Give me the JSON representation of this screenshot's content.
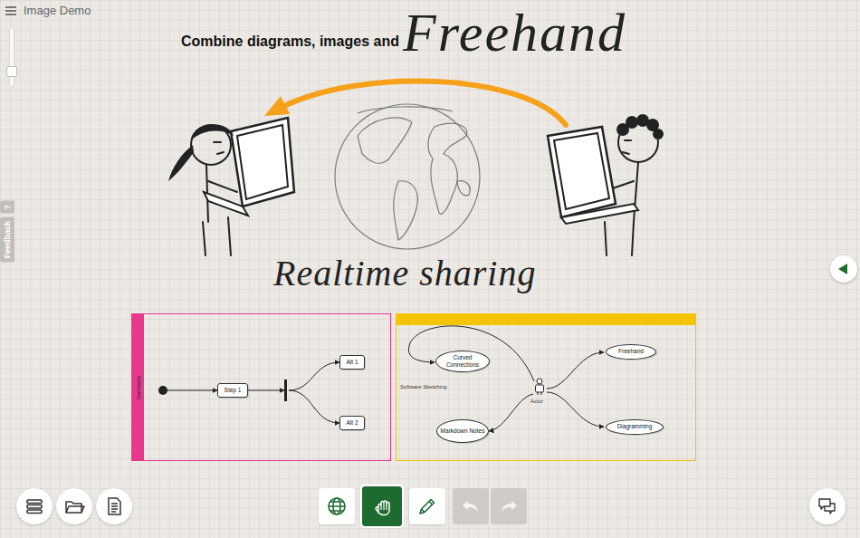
{
  "window": {
    "title": "Image Demo"
  },
  "zoom": {
    "level": 0.2
  },
  "side_tabs": [
    {
      "label": "?"
    },
    {
      "label": "Feedback"
    }
  ],
  "canvas": {
    "heading": "Combine diagrams, images and",
    "freehand_title": "Freehand",
    "caption": "Realtime sharing"
  },
  "frames": [
    {
      "kind": "swimlane",
      "color": "#e8388d",
      "label": "Swimlane",
      "nodes": [
        "Step 1",
        "Alt 1",
        "Alt 2"
      ]
    },
    {
      "kind": "mindmap",
      "color": "#f5c400",
      "label": "Software Sketching",
      "center": "Actor",
      "nodes": [
        "Curved Connections",
        "Freehand",
        "Markdown Notes",
        "Diagramming"
      ]
    }
  ],
  "panel_toggle": {
    "expanded": false
  },
  "file_buttons": [
    {
      "kind": "layers"
    },
    {
      "kind": "open"
    },
    {
      "kind": "notes"
    }
  ],
  "tools": [
    {
      "kind": "globe",
      "selected": false
    },
    {
      "kind": "hand",
      "selected": true
    },
    {
      "kind": "pencil",
      "selected": false
    }
  ],
  "history": [
    {
      "kind": "undo",
      "disabled": true
    },
    {
      "kind": "redo",
      "disabled": true
    }
  ]
}
